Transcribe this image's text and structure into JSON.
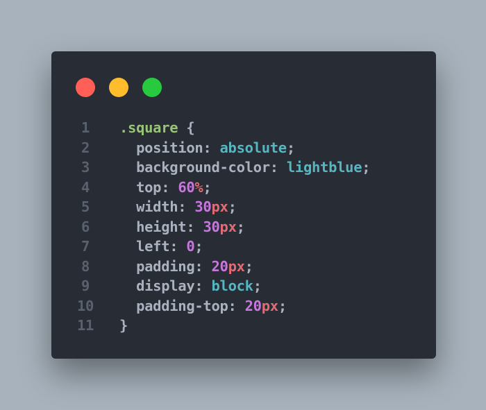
{
  "window": {
    "controls": [
      {
        "name": "close-button",
        "color": "#ff5f56"
      },
      {
        "name": "minimize-button",
        "color": "#ffbd2e"
      },
      {
        "name": "maximize-button",
        "color": "#27c93f"
      }
    ]
  },
  "colors": {
    "selector": "#98c379",
    "brace": "#abb2bf",
    "property": "#abb2bf",
    "punct": "#abb2bf",
    "keyword": "#56b6c2",
    "number": "#c678dd",
    "unit": "#e06c75",
    "line_number": "#5a616e"
  },
  "code": {
    "lines": [
      {
        "number": "1",
        "tokens": [
          {
            "text": ".square ",
            "type": "selector"
          },
          {
            "text": "{",
            "type": "brace"
          }
        ]
      },
      {
        "number": "2",
        "tokens": [
          {
            "text": "  position",
            "type": "property"
          },
          {
            "text": ": ",
            "type": "punct"
          },
          {
            "text": "absolute",
            "type": "keyword"
          },
          {
            "text": ";",
            "type": "punct"
          }
        ]
      },
      {
        "number": "3",
        "tokens": [
          {
            "text": "  background-color",
            "type": "property"
          },
          {
            "text": ": ",
            "type": "punct"
          },
          {
            "text": "lightblue",
            "type": "keyword"
          },
          {
            "text": ";",
            "type": "punct"
          }
        ]
      },
      {
        "number": "4",
        "tokens": [
          {
            "text": "  top",
            "type": "property"
          },
          {
            "text": ": ",
            "type": "punct"
          },
          {
            "text": "60",
            "type": "number"
          },
          {
            "text": "%",
            "type": "unit"
          },
          {
            "text": ";",
            "type": "punct"
          }
        ]
      },
      {
        "number": "5",
        "tokens": [
          {
            "text": "  width",
            "type": "property"
          },
          {
            "text": ": ",
            "type": "punct"
          },
          {
            "text": "30",
            "type": "number"
          },
          {
            "text": "px",
            "type": "unit"
          },
          {
            "text": ";",
            "type": "punct"
          }
        ]
      },
      {
        "number": "6",
        "tokens": [
          {
            "text": "  height",
            "type": "property"
          },
          {
            "text": ": ",
            "type": "punct"
          },
          {
            "text": "30",
            "type": "number"
          },
          {
            "text": "px",
            "type": "unit"
          },
          {
            "text": ";",
            "type": "punct"
          }
        ]
      },
      {
        "number": "7",
        "tokens": [
          {
            "text": "  left",
            "type": "property"
          },
          {
            "text": ": ",
            "type": "punct"
          },
          {
            "text": "0",
            "type": "number"
          },
          {
            "text": ";",
            "type": "punct"
          }
        ]
      },
      {
        "number": "8",
        "tokens": [
          {
            "text": "  padding",
            "type": "property"
          },
          {
            "text": ": ",
            "type": "punct"
          },
          {
            "text": "20",
            "type": "number"
          },
          {
            "text": "px",
            "type": "unit"
          },
          {
            "text": ";",
            "type": "punct"
          }
        ]
      },
      {
        "number": "9",
        "tokens": [
          {
            "text": "  display",
            "type": "property"
          },
          {
            "text": ": ",
            "type": "punct"
          },
          {
            "text": "block",
            "type": "keyword"
          },
          {
            "text": ";",
            "type": "punct"
          }
        ]
      },
      {
        "number": "10",
        "tokens": [
          {
            "text": "  padding-top",
            "type": "property"
          },
          {
            "text": ": ",
            "type": "punct"
          },
          {
            "text": "20",
            "type": "number"
          },
          {
            "text": "px",
            "type": "unit"
          },
          {
            "text": ";",
            "type": "punct"
          }
        ]
      },
      {
        "number": "11",
        "tokens": [
          {
            "text": "}",
            "type": "brace"
          }
        ]
      }
    ]
  }
}
